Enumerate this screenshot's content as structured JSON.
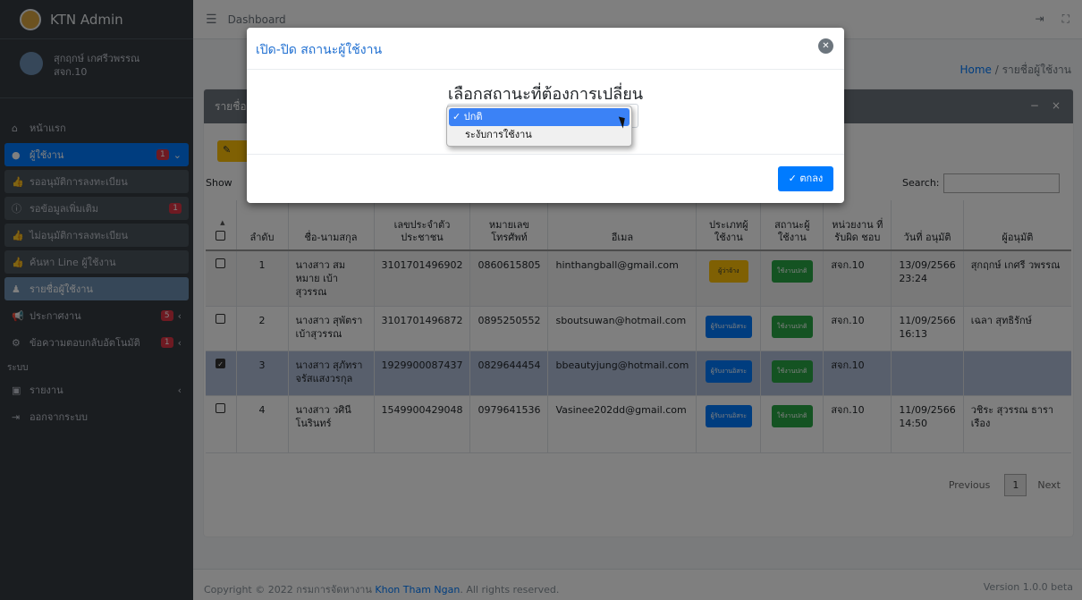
{
  "brand": {
    "name": "KTN Admin"
  },
  "user": {
    "name": "สุกฤกษ์ เกศรีวพรรณ",
    "org": "สจก.10"
  },
  "sidebar": {
    "home": "หน้าแรก",
    "users": {
      "label": "ผู้ใช้งาน",
      "badge": "1"
    },
    "pending": "รออนุมัติการลงทะเบียน",
    "more_info": {
      "label": "รอข้อมูลเพิ่มเติม",
      "badge": "1"
    },
    "not_approved": "ไม่อนุมัติการลงทะเบียน",
    "line_search": "ค้นหา Line ผู้ใช้งาน",
    "user_list": "รายชื่อผู้ใช้งาน",
    "announce": {
      "label": "ประกาศงาน",
      "badge": "5"
    },
    "auto_reply": {
      "label": "ข้อความตอบกลับอัตโนมัติ",
      "badge": "1"
    },
    "system_header": "ระบบ",
    "report": "รายงาน",
    "logout": "ออกจากระบบ"
  },
  "topbar": {
    "crumb": "Dashboard"
  },
  "breadcrumb": {
    "home": "Home",
    "sep": " / ",
    "current": "รายชื่อผู้ใช้งาน"
  },
  "card": {
    "title": "รายชื่อ",
    "show_label": "Show",
    "search_label": "Search:",
    "columns": [
      "ลำดับ",
      "ชื่อ-นามสกุล",
      "เลขประจำตัว ประชาชน",
      "หมายเลข โทรศัพท์",
      "อีเมล",
      "ประเภทผู้ ใช้งาน",
      "สถานะผู้ ใช้งาน",
      "หน่วยงาน ที่รับผิด ชอบ",
      "วันที่ อนุมัติ",
      "ผู้อนุมัติ"
    ],
    "rows": [
      {
        "no": "1",
        "name": "นางสาว สม หมาย เบ้า สุวรรณ",
        "id": "3101701496902",
        "phone": "0860615805",
        "email": "hinthangball@gmail.com",
        "type": "ผู้ว่าจ้าง",
        "status": "ใช้งานปกติ",
        "unit": "สจก.10",
        "date": "13/09/2566 23:24",
        "approver": "สุกฤกษ์ เกศรี วพรรณ"
      },
      {
        "no": "2",
        "name": "นางสาว สุพัตรา เบ้าสุวรรณ",
        "id": "3101701496872",
        "phone": "0895250552",
        "email": "sboutsuwan@hotmail.com",
        "type": "ผู้รับงานอิสระ",
        "status": "ใช้งานปกติ",
        "unit": "สจก.10",
        "date": "11/09/2566 16:13",
        "approver": "เฉลา สุทธิรักษ์"
      },
      {
        "no": "3",
        "name": "นางสาว สุภัทรา จรัสแสงวรกุล",
        "id": "1929900087437",
        "phone": "0829644454",
        "email": "bbeautyjung@hotmail.com",
        "type": "ผู้รับงานอิสระ",
        "status": "ใช้งานปกติ",
        "unit": "สจก.10",
        "date": "",
        "approver": ""
      },
      {
        "no": "4",
        "name": "นางสาว วศินี โนรินทร์",
        "id": "1549900429048",
        "phone": "0979641536",
        "email": "Vasinee202dd@gmail.com",
        "type": "ผู้รับงานอิสระ",
        "status": "ใช้งานปกติ",
        "unit": "สจก.10",
        "date": "11/09/2566 14:50",
        "approver": "วชิระ สุวรรณ ธาราเรือง"
      }
    ],
    "pager": {
      "prev": "Previous",
      "current": "1",
      "next": "Next"
    }
  },
  "footer": {
    "copyright": "Copyright © 2022 กรมการจัดหางาน ",
    "link": "Khon Tham Ngan",
    "rights": ". All rights reserved.",
    "version": "Version 1.0.0 beta"
  },
  "modal": {
    "title": "เปิด-ปิด สถานะผู้ใช้งาน",
    "heading": "เลือกสถานะที่ต้องการเปลี่ยน",
    "options": [
      "✓ ปกติ",
      "ระงับการใช้งาน"
    ],
    "ok_label": "✓ ตกลง"
  }
}
